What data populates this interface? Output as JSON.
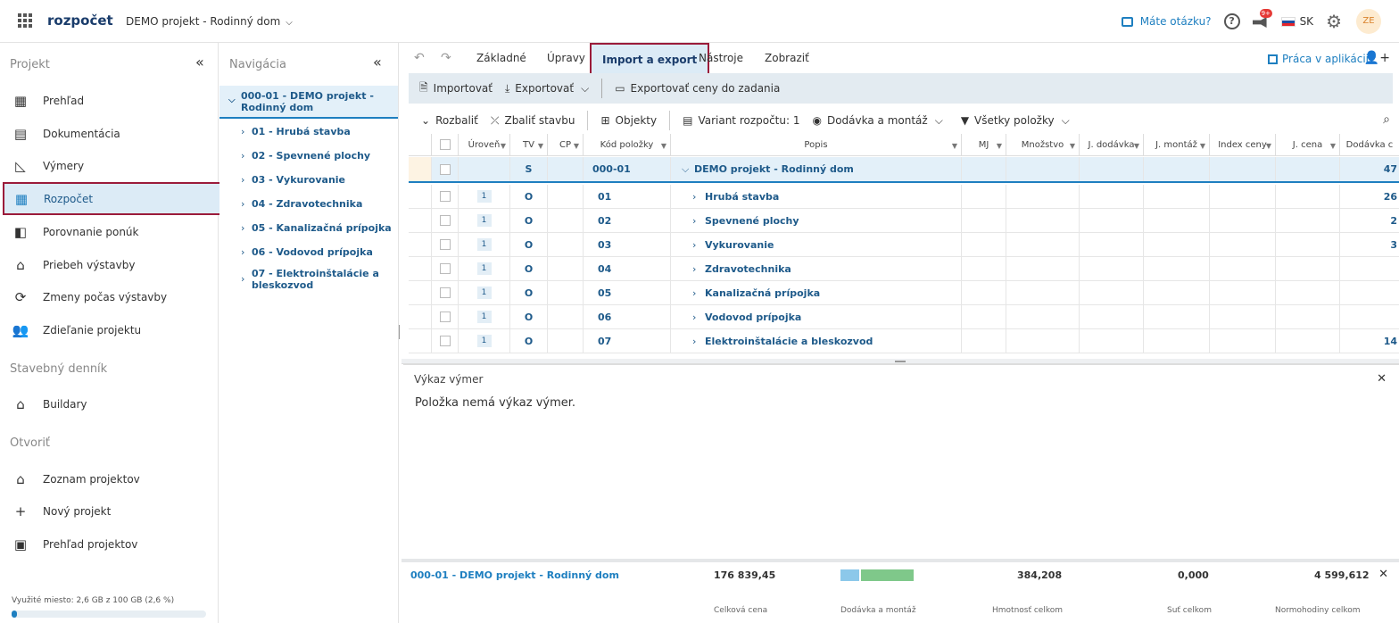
{
  "header": {
    "app_name": "rozpočet",
    "project": "DEMO projekt - Rodinný dom",
    "question_link": "Máte otázku?",
    "help": "?",
    "notif_badge": "9+",
    "lang": "SK",
    "avatar": "ZE"
  },
  "project_panel": {
    "title": "Projekt",
    "items": [
      {
        "label": "Prehľad",
        "icon": "dashboard-icon"
      },
      {
        "label": "Dokumentácia",
        "icon": "document-icon"
      },
      {
        "label": "Výmery",
        "icon": "measure-icon"
      },
      {
        "label": "Rozpočet",
        "icon": "budget-table-icon"
      },
      {
        "label": "Porovnanie ponúk",
        "icon": "compare-icon"
      },
      {
        "label": "Priebeh výstavby",
        "icon": "progress-icon"
      },
      {
        "label": "Zmeny počas výstavby",
        "icon": "changes-icon"
      },
      {
        "label": "Zdieľanie projektu",
        "icon": "people-icon"
      }
    ],
    "diary_title": "Stavebný denník",
    "diary_items": [
      {
        "label": "Buildary",
        "icon": "buildary-icon"
      }
    ],
    "open_title": "Otvoriť",
    "open_items": [
      {
        "label": "Zoznam projektov",
        "icon": "home-icon"
      },
      {
        "label": "Nový projekt",
        "icon": "plus-icon"
      },
      {
        "label": "Prehľad projektov",
        "icon": "chart-icon"
      }
    ],
    "storage_text": "Využité miesto: 2,6 GB z 100 GB (2,6 %)",
    "storage_fraction": 0.026
  },
  "nav_panel": {
    "title": "Navigácia",
    "root": "000-01 - DEMO projekt - Rodinný dom",
    "items": [
      "01 - Hrubá stavba",
      "02 - Spevnené plochy",
      "03 - Vykurovanie",
      "04 - Zdravotechnika",
      "05 - Kanalizačná prípojka",
      "06 - Vodovod prípojka",
      "07 - Elektroinštalácie a bleskozvod"
    ]
  },
  "tabs": {
    "items": [
      "Základné",
      "Úpravy",
      "Import a export",
      "Nástroje",
      "Zobraziť"
    ],
    "active": "Import a export",
    "work_link": "Práca v aplikácii"
  },
  "ribbon": {
    "import": "Importovať",
    "export": "Exportovať",
    "export_prices": "Exportovať ceny do zadania"
  },
  "toolbar": {
    "expand": "Rozbaliť",
    "collapse": "Zbaliť stavbu",
    "objects": "Objekty",
    "variant": "Variant rozpočtu: 1",
    "delivery": "Dodávka a montáž",
    "all_items": "Všetky položky"
  },
  "table": {
    "headers": [
      "Úroveň",
      "TV",
      "CP",
      "Kód položky",
      "Popis",
      "MJ",
      "Množstvo",
      "J. dodávka",
      "J. montáž",
      "Index ceny",
      "J. cena",
      "Dodávka c"
    ],
    "root_row": {
      "tv": "S",
      "code": "000-01",
      "desc": "DEMO projekt - Rodinný dom",
      "dodavka": "47"
    },
    "rows": [
      {
        "level": "1",
        "tv": "O",
        "code": "01",
        "desc": "Hrubá stavba",
        "dodavka": "26"
      },
      {
        "level": "1",
        "tv": "O",
        "code": "02",
        "desc": "Spevnené plochy",
        "dodavka": "2"
      },
      {
        "level": "1",
        "tv": "O",
        "code": "03",
        "desc": "Vykurovanie",
        "dodavka": "3"
      },
      {
        "level": "1",
        "tv": "O",
        "code": "04",
        "desc": "Zdravotechnika",
        "dodavka": ""
      },
      {
        "level": "1",
        "tv": "O",
        "code": "05",
        "desc": "Kanalizačná prípojka",
        "dodavka": ""
      },
      {
        "level": "1",
        "tv": "O",
        "code": "06",
        "desc": "Vodovod prípojka",
        "dodavka": ""
      },
      {
        "level": "1",
        "tv": "O",
        "code": "07",
        "desc": "Elektroinštalácie a bleskozvod",
        "dodavka": "14"
      }
    ]
  },
  "vykaz": {
    "title": "Výkaz výmer",
    "message": "Položka nemá výkaz výmer."
  },
  "footer": {
    "name": "000-01 - DEMO projekt - Rodinný dom",
    "total_price": "176 839,45",
    "weight": "384,208",
    "sut": "0,000",
    "hours": "4 599,612",
    "labels": {
      "total_price": "Celková cena",
      "delivery": "Dodávka a montáž",
      "weight": "Hmotnosť celkom",
      "sut": "Suť celkom",
      "hours": "Normohodiny celkom"
    }
  },
  "colors": {
    "accent": "#1e7fc0",
    "highlight_border": "#9b1b3a",
    "active_bg": "#dcebf6"
  }
}
